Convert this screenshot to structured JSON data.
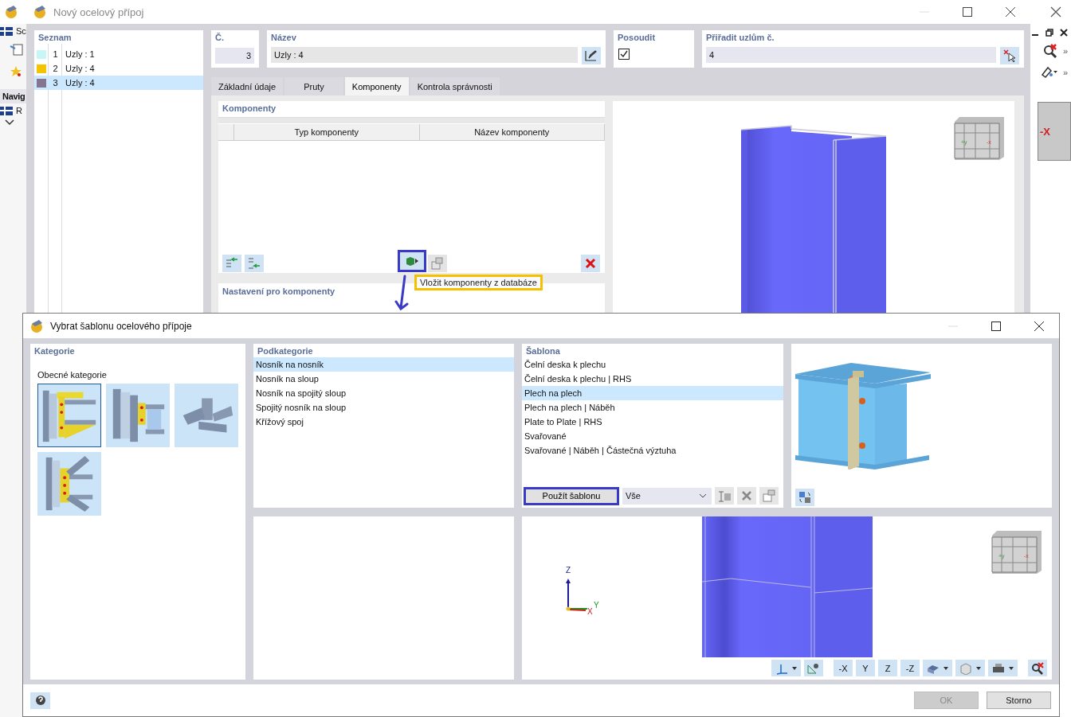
{
  "background_app": {
    "toolbar_label": "Sc",
    "navigator_title": "Navig",
    "tree_item": "R",
    "cube_label": "-X",
    "overflow_marks": [
      "»",
      "»"
    ]
  },
  "main_dialog": {
    "title": "Nový ocelový přípoj",
    "list": {
      "title": "Seznam",
      "items": [
        {
          "number": "1",
          "label": "Uzly : 1",
          "color": "#c6f6f6",
          "selected": false
        },
        {
          "number": "2",
          "label": "Uzly : 4",
          "color": "#f5c400",
          "selected": false
        },
        {
          "number": "3",
          "label": "Uzly : 4",
          "color": "#857590",
          "selected": true
        }
      ]
    },
    "number_field": {
      "label": "Č.",
      "value": "3"
    },
    "name_field": {
      "label": "Název",
      "value": "Uzly : 4"
    },
    "design": {
      "label": "Posoudit",
      "checked": true
    },
    "assign_nodes": {
      "label": "Přiřadit uzlům č.",
      "value": "4"
    },
    "tabs": [
      {
        "label": "Základní údaje",
        "selected": false
      },
      {
        "label": "Pruty",
        "selected": false
      },
      {
        "label": "Komponenty",
        "selected": true
      },
      {
        "label": "Kontrola správnosti",
        "selected": false
      }
    ],
    "components": {
      "title": "Komponenty",
      "columns": [
        "Typ komponenty",
        "Název komponenty"
      ],
      "insert_highlighted": true,
      "tooltip": "Vložit komponenty z databáze"
    },
    "settings": {
      "title": "Nastavení pro komponenty"
    },
    "view_cube": {
      "left": "+y",
      "right": "-x"
    }
  },
  "template_dialog": {
    "title": "Vybrat šablonu ocelového přípoje",
    "categories": {
      "title": "Kategorie",
      "group": "Obecné kategorie",
      "items": [
        {
          "kind": "haunch",
          "selected": true
        },
        {
          "kind": "end-plate",
          "selected": false
        },
        {
          "kind": "tube",
          "selected": false
        },
        {
          "kind": "bracing",
          "selected": false
        }
      ]
    },
    "subcategories": {
      "title": "Podkategorie",
      "items": [
        {
          "label": "Nosník na nosník",
          "selected": true
        },
        {
          "label": "Nosník na sloup",
          "selected": false
        },
        {
          "label": "Nosník na spojitý sloup",
          "selected": false
        },
        {
          "label": "Spojitý nosník na sloup",
          "selected": false
        },
        {
          "label": "Křížový spoj",
          "selected": false
        }
      ]
    },
    "templates": {
      "title": "Šablona",
      "items": [
        {
          "label": "Čelní deska k plechu",
          "selected": false
        },
        {
          "label": "Čelní deska k plechu | RHS",
          "selected": false
        },
        {
          "label": "Plech na plech",
          "selected": true
        },
        {
          "label": "Plech na plech | Náběh",
          "selected": false
        },
        {
          "label": "Plate to Plate | RHS",
          "selected": false
        },
        {
          "label": "Svařované",
          "selected": false
        },
        {
          "label": "Svařované | Náběh | Částečná výztuha",
          "selected": false
        }
      ],
      "apply_button": {
        "label": "Použít šablonu",
        "highlighted": true
      },
      "filter": "Vše"
    },
    "view": {
      "axes": {
        "z": "Z",
        "y": "Y",
        "x": "X"
      },
      "view_cube": {
        "left": "+y",
        "right": "-x"
      },
      "view_buttons": [
        "-X",
        "Y",
        "Z",
        "-Z"
      ]
    },
    "ok_button": {
      "label": "OK",
      "disabled": true
    },
    "cancel_button": {
      "label": "Storno",
      "disabled": false
    }
  }
}
